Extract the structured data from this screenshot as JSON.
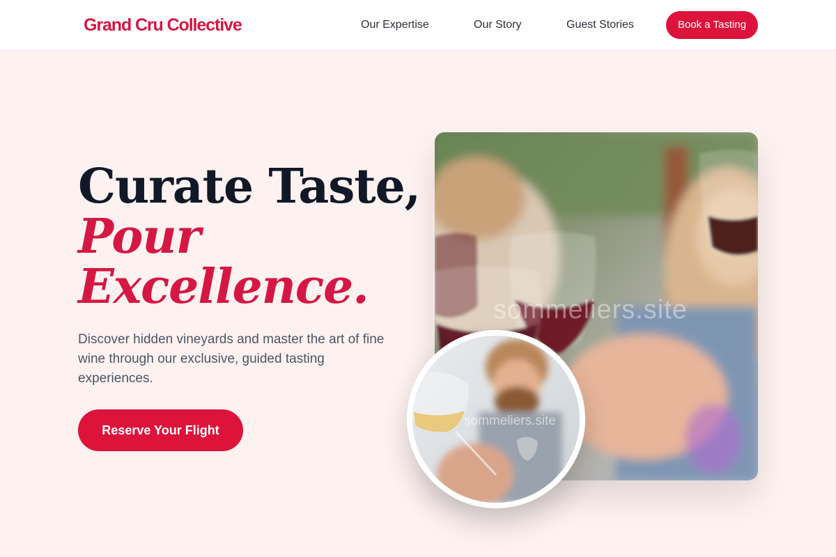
{
  "nav": {
    "logo": "Grand Cru Collective",
    "links": [
      "Our Expertise",
      "Our Story",
      "Guest Stories"
    ],
    "cta": "Book a Tasting"
  },
  "hero": {
    "title_line1": "Curate Taste,",
    "title_line2": "Pour",
    "title_line3": "Excellence.",
    "description": "Discover hidden vineyards and master the art of fine wine through our exclusive, guided tasting experiences.",
    "cta": "Reserve Your Flight"
  },
  "images": {
    "main_watermark": "sommeliers.site",
    "circle_watermark": "sommeliers.site"
  },
  "colors": {
    "accent": "#dc143c",
    "background": "#fef2f1",
    "heading": "#111827"
  }
}
